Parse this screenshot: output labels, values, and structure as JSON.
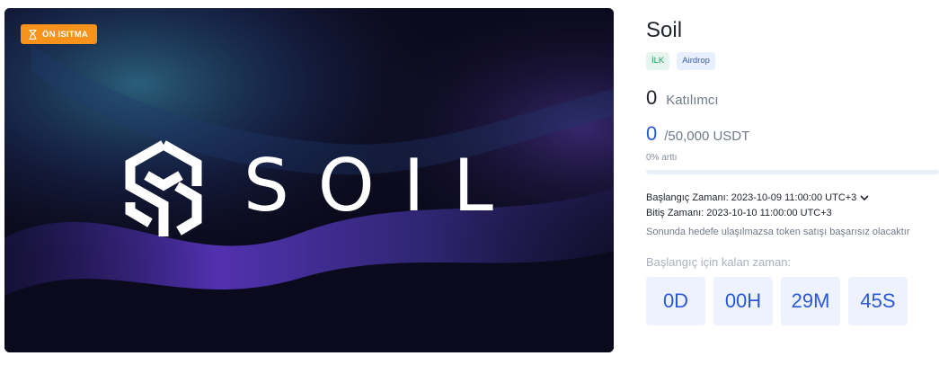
{
  "banner": {
    "badge_label": "ÖN ISITMA",
    "badge_icon": "hourglass-icon",
    "logo_text": "SOIL",
    "badge_color": "#f7931a"
  },
  "project": {
    "name": "Soil",
    "tags": [
      "İLK",
      "Airdrop"
    ]
  },
  "participants": {
    "count": "0",
    "label": "Katılımcı"
  },
  "raise": {
    "amount": "0",
    "goal": "/50,000 USDT",
    "percent_label": "0% arttı",
    "progress": 0
  },
  "schedule": {
    "start": "Başlangıç Zamanı: 2023-10-09 11:00:00 UTC+3",
    "end": "Bitiş Zamanı: 2023-10-10 11:00:00 UTC+3",
    "warning": "Sonunda hedefe ulaşılmazsa token satışı başarısız olacaktır"
  },
  "countdown": {
    "label": "Başlangıç için kalan zaman:",
    "days": "0D",
    "hours": "00H",
    "minutes": "29M",
    "seconds": "45S"
  },
  "colors": {
    "accent": "#2b59d6",
    "tag_first_bg": "#e6f6ee",
    "tag_airdrop_bg": "#e8efff"
  }
}
